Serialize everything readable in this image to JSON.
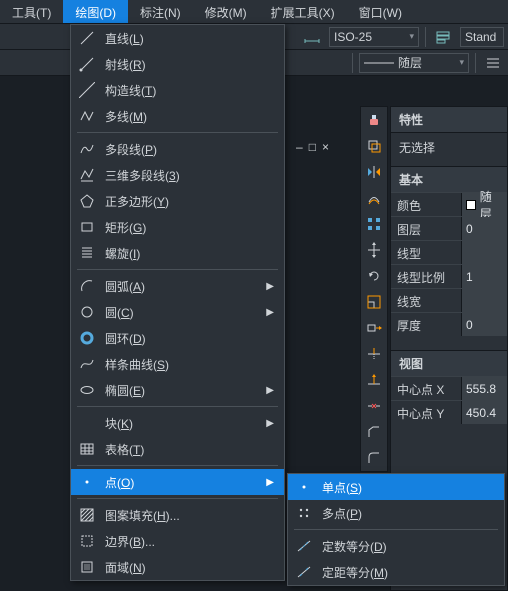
{
  "menubar": [
    {
      "label": "工具(T)"
    },
    {
      "label": "绘图(D)",
      "active": true
    },
    {
      "label": "标注(N)"
    },
    {
      "label": "修改(M)"
    },
    {
      "label": "扩展工具(X)"
    },
    {
      "label": "窗口(W)"
    }
  ],
  "toolbar_top": {
    "dimstyle_combo": "ISO-25",
    "textstyle_label": "Stand"
  },
  "toolbar_second": {
    "layer_label": "随层"
  },
  "tabstrip": {
    "item": "随"
  },
  "dropdown_main": [
    {
      "icon": "line",
      "label": "直线(",
      "u": "L",
      "rest": ")"
    },
    {
      "icon": "ray",
      "label": "射线(",
      "u": "R",
      "rest": ")"
    },
    {
      "icon": "xline",
      "label": "构造线(",
      "u": "T",
      "rest": ")"
    },
    {
      "icon": "mline",
      "label": "多线(",
      "u": "M",
      "rest": ")"
    },
    {
      "sep": true
    },
    {
      "icon": "pline",
      "label": "多段线(",
      "u": "P",
      "rest": ")"
    },
    {
      "icon": "3dpoly",
      "label": "三维多段线(",
      "u": "3",
      "rest": ")"
    },
    {
      "icon": "polygon",
      "label": "正多边形(",
      "u": "Y",
      "rest": ")"
    },
    {
      "icon": "rect",
      "label": "矩形(",
      "u": "G",
      "rest": ")"
    },
    {
      "icon": "helix",
      "label": "螺旋(",
      "u": "I",
      "rest": ")"
    },
    {
      "sep": true
    },
    {
      "icon": "arc",
      "label": "圆弧(",
      "u": "A",
      "rest": ")",
      "sub": true
    },
    {
      "icon": "circle",
      "label": "圆(",
      "u": "C",
      "rest": ")",
      "sub": true
    },
    {
      "icon": "donut",
      "label": "圆环(",
      "u": "D",
      "rest": ")"
    },
    {
      "icon": "spline",
      "label": "样条曲线(",
      "u": "S",
      "rest": ")"
    },
    {
      "icon": "ellipse",
      "label": "椭圆(",
      "u": "E",
      "rest": ")",
      "sub": true
    },
    {
      "sep": true
    },
    {
      "icon": "block",
      "label": "块(",
      "u": "K",
      "rest": ")",
      "sub": true
    },
    {
      "icon": "table",
      "label": "表格(",
      "u": "T",
      "rest": ")"
    },
    {
      "sep": true
    },
    {
      "icon": "point",
      "label": "点(",
      "u": "O",
      "rest": ")",
      "sub": true,
      "hl": true
    },
    {
      "sep": true
    },
    {
      "icon": "hatch",
      "label": "图案填充(",
      "u": "H",
      "rest": ")..."
    },
    {
      "icon": "boundary",
      "label": "边界(",
      "u": "B",
      "rest": ")..."
    },
    {
      "icon": "region",
      "label": "面域(",
      "u": "N",
      "rest": ")"
    }
  ],
  "dropdown_sub": [
    {
      "icon": "pt1",
      "label": "单点(",
      "u": "S",
      "rest": ")",
      "hl": true
    },
    {
      "icon": "ptm",
      "label": "多点(",
      "u": "P",
      "rest": ")"
    },
    {
      "sep": true
    },
    {
      "icon": "divide",
      "label": "定数等分(",
      "u": "D",
      "rest": ")"
    },
    {
      "icon": "measure",
      "label": "定距等分(",
      "u": "M",
      "rest": ")"
    }
  ],
  "vtoolbar": [
    "erase",
    "copy",
    "mirror",
    "offset",
    "array",
    "move",
    "rotate",
    "scale",
    "stretch",
    "trim",
    "extend",
    "break",
    "chamfer",
    "fillet"
  ],
  "props": {
    "title": "特性",
    "selection": "无选择",
    "sections": [
      {
        "header": "基本",
        "rows": [
          {
            "k": "颜色",
            "v": "随层",
            "swatch": true
          },
          {
            "k": "图层",
            "v": "0"
          },
          {
            "k": "线型",
            "v": ""
          },
          {
            "k": "线型比例",
            "v": "1"
          },
          {
            "k": "线宽",
            "v": ""
          },
          {
            "k": "厚度",
            "v": "0"
          }
        ]
      },
      {
        "header": "视图",
        "rows": [
          {
            "k": "中心点 X",
            "v": "555.8"
          },
          {
            "k": "中心点 Y",
            "v": "450.4"
          }
        ]
      }
    ]
  },
  "doc_controls": [
    "–",
    "□",
    "×"
  ]
}
